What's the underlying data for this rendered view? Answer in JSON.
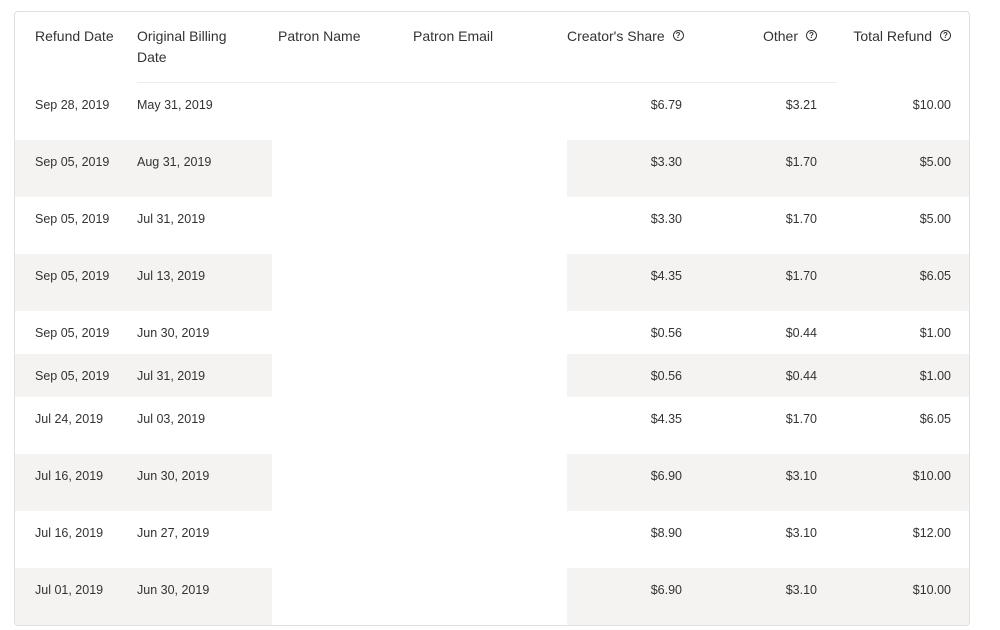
{
  "columns": {
    "refund_date": "Refund Date",
    "original_billing_date": "Original Billing Date",
    "patron_name": "Patron Name",
    "patron_email": "Patron Email",
    "creators_share": "Creator's Share",
    "other": "Other",
    "total_refund": "Total Refund"
  },
  "icons": {
    "help": "question-circle-icon"
  },
  "colors": {
    "row_shade": "#f4f3f1",
    "border": "#e0e0e0"
  },
  "rows": [
    {
      "refund_date": "Sep 28, 2019",
      "billing_date": "May 31, 2019",
      "patron_name": "",
      "patron_email": "",
      "creators_share": "$6.79",
      "other": "$3.21",
      "total": "$10.00"
    },
    {
      "refund_date": "Sep 05, 2019",
      "billing_date": "Aug 31, 2019",
      "patron_name": "",
      "patron_email": "",
      "creators_share": "$3.30",
      "other": "$1.70",
      "total": "$5.00"
    },
    {
      "refund_date": "Sep 05, 2019",
      "billing_date": "Jul 31, 2019",
      "patron_name": "",
      "patron_email": "",
      "creators_share": "$3.30",
      "other": "$1.70",
      "total": "$5.00"
    },
    {
      "refund_date": "Sep 05, 2019",
      "billing_date": "Jul 13, 2019",
      "patron_name": "",
      "patron_email": "",
      "creators_share": "$4.35",
      "other": "$1.70",
      "total": "$6.05"
    },
    {
      "refund_date": "Sep 05, 2019",
      "billing_date": "Jun 30, 2019",
      "patron_name": "",
      "patron_email": "",
      "creators_share": "$0.56",
      "other": "$0.44",
      "total": "$1.00"
    },
    {
      "refund_date": "Sep 05, 2019",
      "billing_date": "Jul 31, 2019",
      "patron_name": "",
      "patron_email": "",
      "creators_share": "$0.56",
      "other": "$0.44",
      "total": "$1.00"
    },
    {
      "refund_date": "Jul 24, 2019",
      "billing_date": "Jul 03, 2019",
      "patron_name": "",
      "patron_email": "",
      "creators_share": "$4.35",
      "other": "$1.70",
      "total": "$6.05"
    },
    {
      "refund_date": "Jul 16, 2019",
      "billing_date": "Jun 30, 2019",
      "patron_name": "",
      "patron_email": "",
      "creators_share": "$6.90",
      "other": "$3.10",
      "total": "$10.00"
    },
    {
      "refund_date": "Jul 16, 2019",
      "billing_date": "Jun 27, 2019",
      "patron_name": "",
      "patron_email": "",
      "creators_share": "$8.90",
      "other": "$3.10",
      "total": "$12.00"
    },
    {
      "refund_date": "Jul 01, 2019",
      "billing_date": "Jun 30, 2019",
      "patron_name": "",
      "patron_email": "",
      "creators_share": "$6.90",
      "other": "$3.10",
      "total": "$10.00"
    }
  ]
}
